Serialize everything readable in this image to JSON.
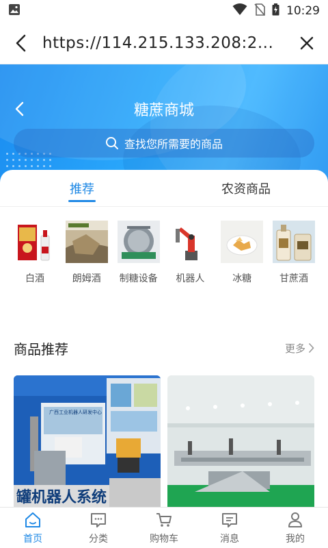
{
  "status_bar": {
    "time": "10:29"
  },
  "browser": {
    "url": "https://114.215.133.208:2..."
  },
  "header": {
    "title": "糖蔗商城",
    "search_placeholder": "查找您所需要的商品"
  },
  "tabs": [
    {
      "label": "推荐",
      "active": true
    },
    {
      "label": "农资商品",
      "active": false
    }
  ],
  "categories": [
    {
      "label": "白酒"
    },
    {
      "label": "朗姆酒"
    },
    {
      "label": "制糖设备"
    },
    {
      "label": "机器人"
    },
    {
      "label": "冰糖"
    },
    {
      "label": "甘蔗酒"
    }
  ],
  "section": {
    "title": "商品推荐",
    "more": "更多"
  },
  "products": [
    {
      "caption": "罐机器人系统",
      "sign": "广西工业机器人研发中心"
    },
    {
      "caption": ""
    }
  ],
  "bottom_nav": [
    {
      "label": "首页",
      "icon": "home-icon",
      "active": true
    },
    {
      "label": "分类",
      "icon": "category-chat-icon",
      "active": false
    },
    {
      "label": "购物车",
      "icon": "cart-icon",
      "active": false
    },
    {
      "label": "消息",
      "icon": "message-icon",
      "active": false
    },
    {
      "label": "我的",
      "icon": "user-icon",
      "active": false
    }
  ],
  "colors": {
    "accent": "#1e88e5",
    "hero": "#2aa7fb"
  }
}
